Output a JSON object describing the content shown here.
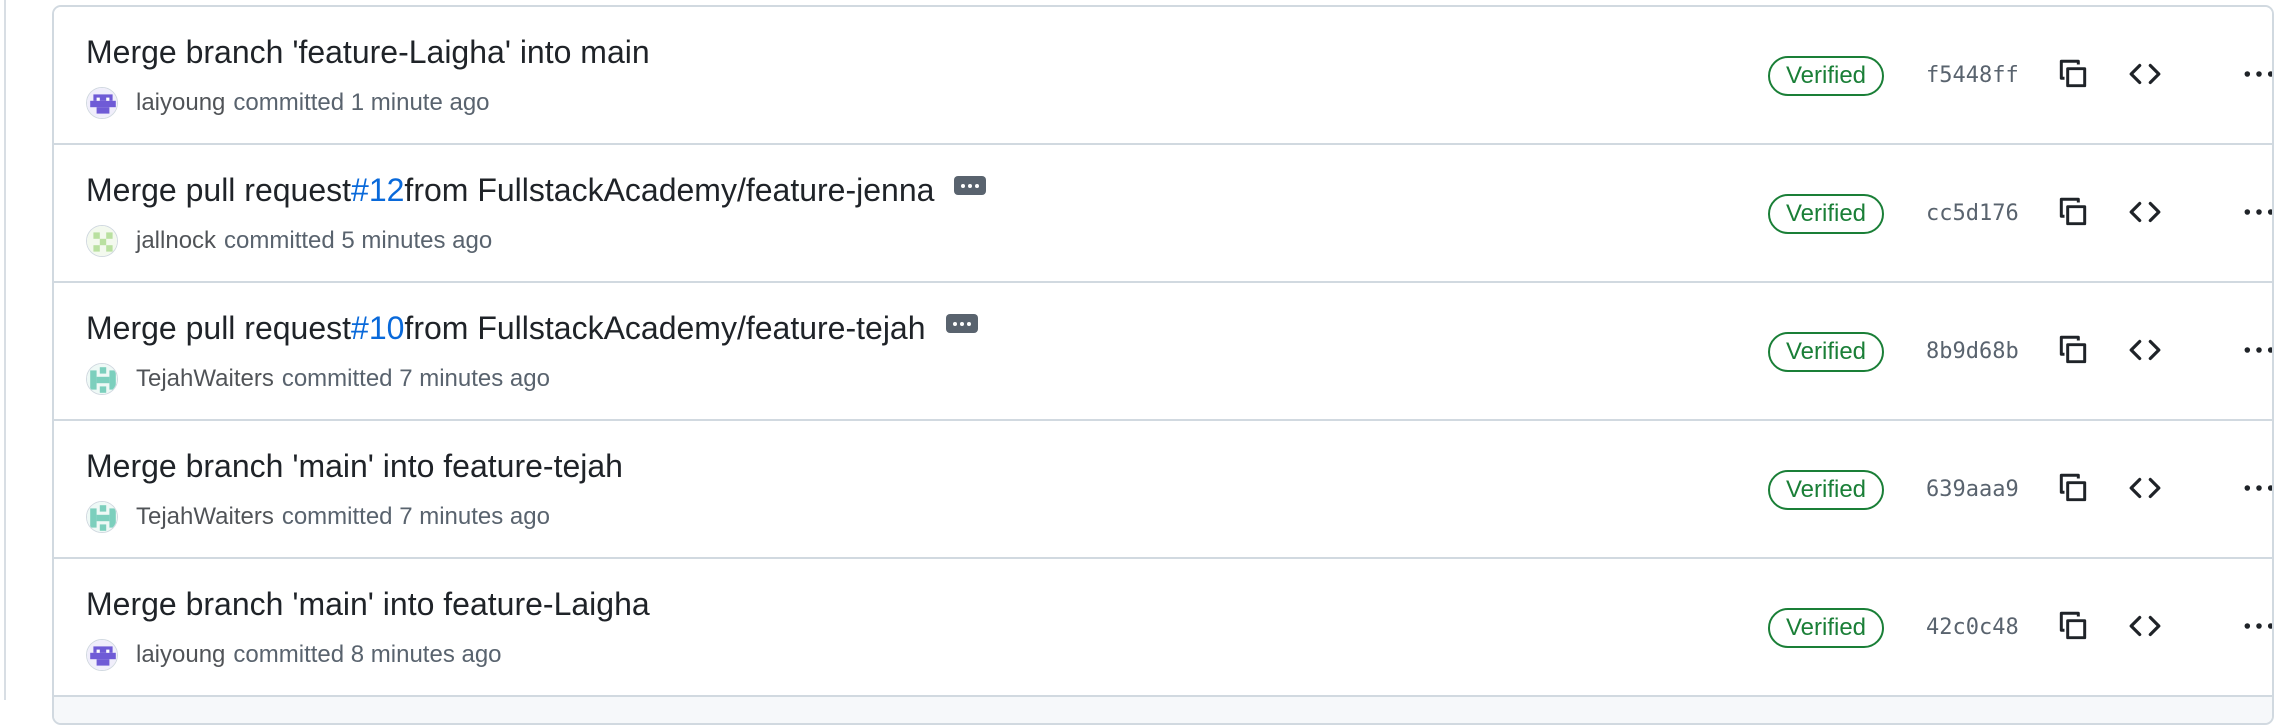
{
  "commits": [
    {
      "title": "Merge branch 'feature-Laigha' into main",
      "pr_number": "",
      "title_rest": "",
      "has_more": false,
      "author": "laiyoung",
      "committed": "committed 1 minute ago",
      "verified": "Verified",
      "sha": "f5448ff",
      "avatar_color": "#6f5bd6"
    },
    {
      "title": "Merge pull request ",
      "pr_number": "#12",
      "title_rest": " from FullstackAcademy/feature-jenna",
      "has_more": true,
      "author": "jallnock",
      "committed": "committed 5 minutes ago",
      "verified": "Verified",
      "sha": "cc5d176",
      "avatar_color": "#b9e0a0"
    },
    {
      "title": "Merge pull request ",
      "pr_number": "#10",
      "title_rest": " from FullstackAcademy/feature-tejah",
      "has_more": true,
      "author": "TejahWaiters",
      "committed": "committed 7 minutes ago",
      "verified": "Verified",
      "sha": "8b9d68b",
      "avatar_color": "#7ccfbd"
    },
    {
      "title": "Merge branch 'main' into feature-tejah",
      "pr_number": "",
      "title_rest": "",
      "has_more": false,
      "author": "TejahWaiters",
      "committed": "committed 7 minutes ago",
      "verified": "Verified",
      "sha": "639aaa9",
      "avatar_color": "#7ccfbd"
    },
    {
      "title": "Merge branch 'main' into feature-Laigha",
      "pr_number": "",
      "title_rest": "",
      "has_more": false,
      "author": "laiyoung",
      "committed": "committed 8 minutes ago",
      "verified": "Verified",
      "sha": "42c0c48",
      "avatar_color": "#6f5bd6"
    }
  ],
  "icons": {
    "copy": "copy-icon",
    "code": "code-icon",
    "more": "kebab-horizontal-icon",
    "ellipsis": "ellipsis-icon"
  },
  "colors": {
    "verified": "#1a7f37",
    "link": "#0969da",
    "border": "#d1d9e0"
  }
}
